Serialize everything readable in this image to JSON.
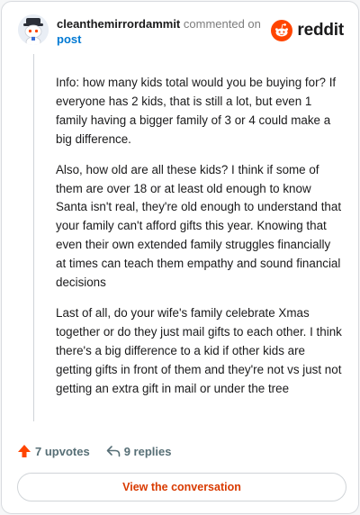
{
  "header": {
    "username": "cleanthemirrordammit",
    "action_text": "commented on",
    "target_link": "post"
  },
  "brand": {
    "logo_text": "reddit",
    "color": "#ff4500"
  },
  "comment": {
    "paragraphs": [
      "Info: how many kids total would you be buying for? If everyone has 2 kids, that is still a lot, but even 1 family having a bigger family of 3 or 4 could make a big difference.",
      "Also, how old are all these kids? I think if some of them are over 18 or at least old enough to know Santa isn't real, they're old enough to understand that your family can't afford gifts this year. Knowing that even their own extended family struggles financially at times can teach them empathy and sound financial decisions",
      "Last of all, do your wife's family celebrate Xmas together or do they just mail gifts to each other. I think there's a big difference to a kid if other kids are getting gifts in front of them and they're not vs just not getting an extra gift in mail or under the tree"
    ]
  },
  "actions": {
    "upvotes": "7 upvotes",
    "replies": "9 replies"
  },
  "cta": {
    "label": "View the conversation",
    "color": "#d93a00"
  },
  "icons": {
    "upvote": "upvote-arrow-icon",
    "reply": "reply-arrow-icon",
    "avatar": "snoo-avatar-icon",
    "logo": "reddit-snoo-icon"
  }
}
